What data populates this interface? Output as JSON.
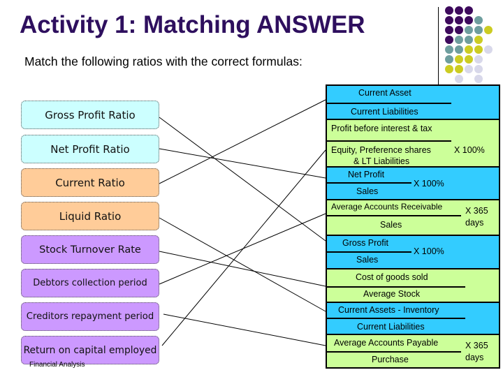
{
  "title": "Activity 1: Matching ANSWER",
  "subtitle": "Match the following ratios with the correct formulas:",
  "footer": "Financial Analysis",
  "colors": {
    "title": "#2e0f5e",
    "ratio_cyan": "#ccffff",
    "ratio_orange": "#ffcc99",
    "ratio_purple": "#cc99ff",
    "formula_blue": "#33ccff",
    "formula_green": "#ccff99",
    "dot_purple": "#3d0a5c",
    "dot_teal": "#6e9e9e",
    "dot_yellow": "#cccc22",
    "dot_lavender": "#d8d8ea"
  },
  "ratios": [
    {
      "label": "Gross Profit Ratio",
      "color": "cyan",
      "matches": "gross_profit"
    },
    {
      "label": "Net Profit Ratio",
      "color": "cyan",
      "matches": "net_profit"
    },
    {
      "label": "Current Ratio",
      "color": "orange",
      "matches": "current"
    },
    {
      "label": "Liquid Ratio",
      "color": "orange",
      "matches": "liquid"
    },
    {
      "label": "Stock Turnover Rate",
      "color": "purple",
      "matches": "stock_turnover"
    },
    {
      "label": "Debtors collection period",
      "color": "purple",
      "matches": "debtors"
    },
    {
      "label": "Creditors repayment period",
      "color": "purple",
      "matches": "creditors"
    },
    {
      "label": "Return on capital employed",
      "color": "purple",
      "matches": "roce"
    }
  ],
  "formulas": {
    "current": {
      "numerator": "Current Asset",
      "denominator": "Current Liabilities",
      "multiplier": ""
    },
    "roce": {
      "numerator": "Profit before interest & tax",
      "denominator": "Equity, Preference shares",
      "denominator2": "& LT Liabilities",
      "multiplier": "X 100%"
    },
    "net_profit": {
      "numerator": "Net Profit",
      "denominator": "Sales",
      "multiplier": "X 100%"
    },
    "debtors": {
      "numerator": "Average Accounts Receivable",
      "denominator": "Sales",
      "multiplier": "X 365",
      "multiplier2": "days"
    },
    "gross_profit": {
      "numerator": "Gross Profit",
      "denominator": "Sales",
      "multiplier": "X 100%"
    },
    "stock_turnover": {
      "numerator": "Cost of goods sold",
      "denominator": "Average Stock",
      "multiplier": ""
    },
    "liquid": {
      "numerator": "Current Assets - Inventory",
      "denominator": "Current Liabilities",
      "multiplier": ""
    },
    "creditors": {
      "numerator": "Average Accounts Payable",
      "denominator": "Purchase",
      "multiplier": "X 365",
      "multiplier2": "days"
    }
  }
}
